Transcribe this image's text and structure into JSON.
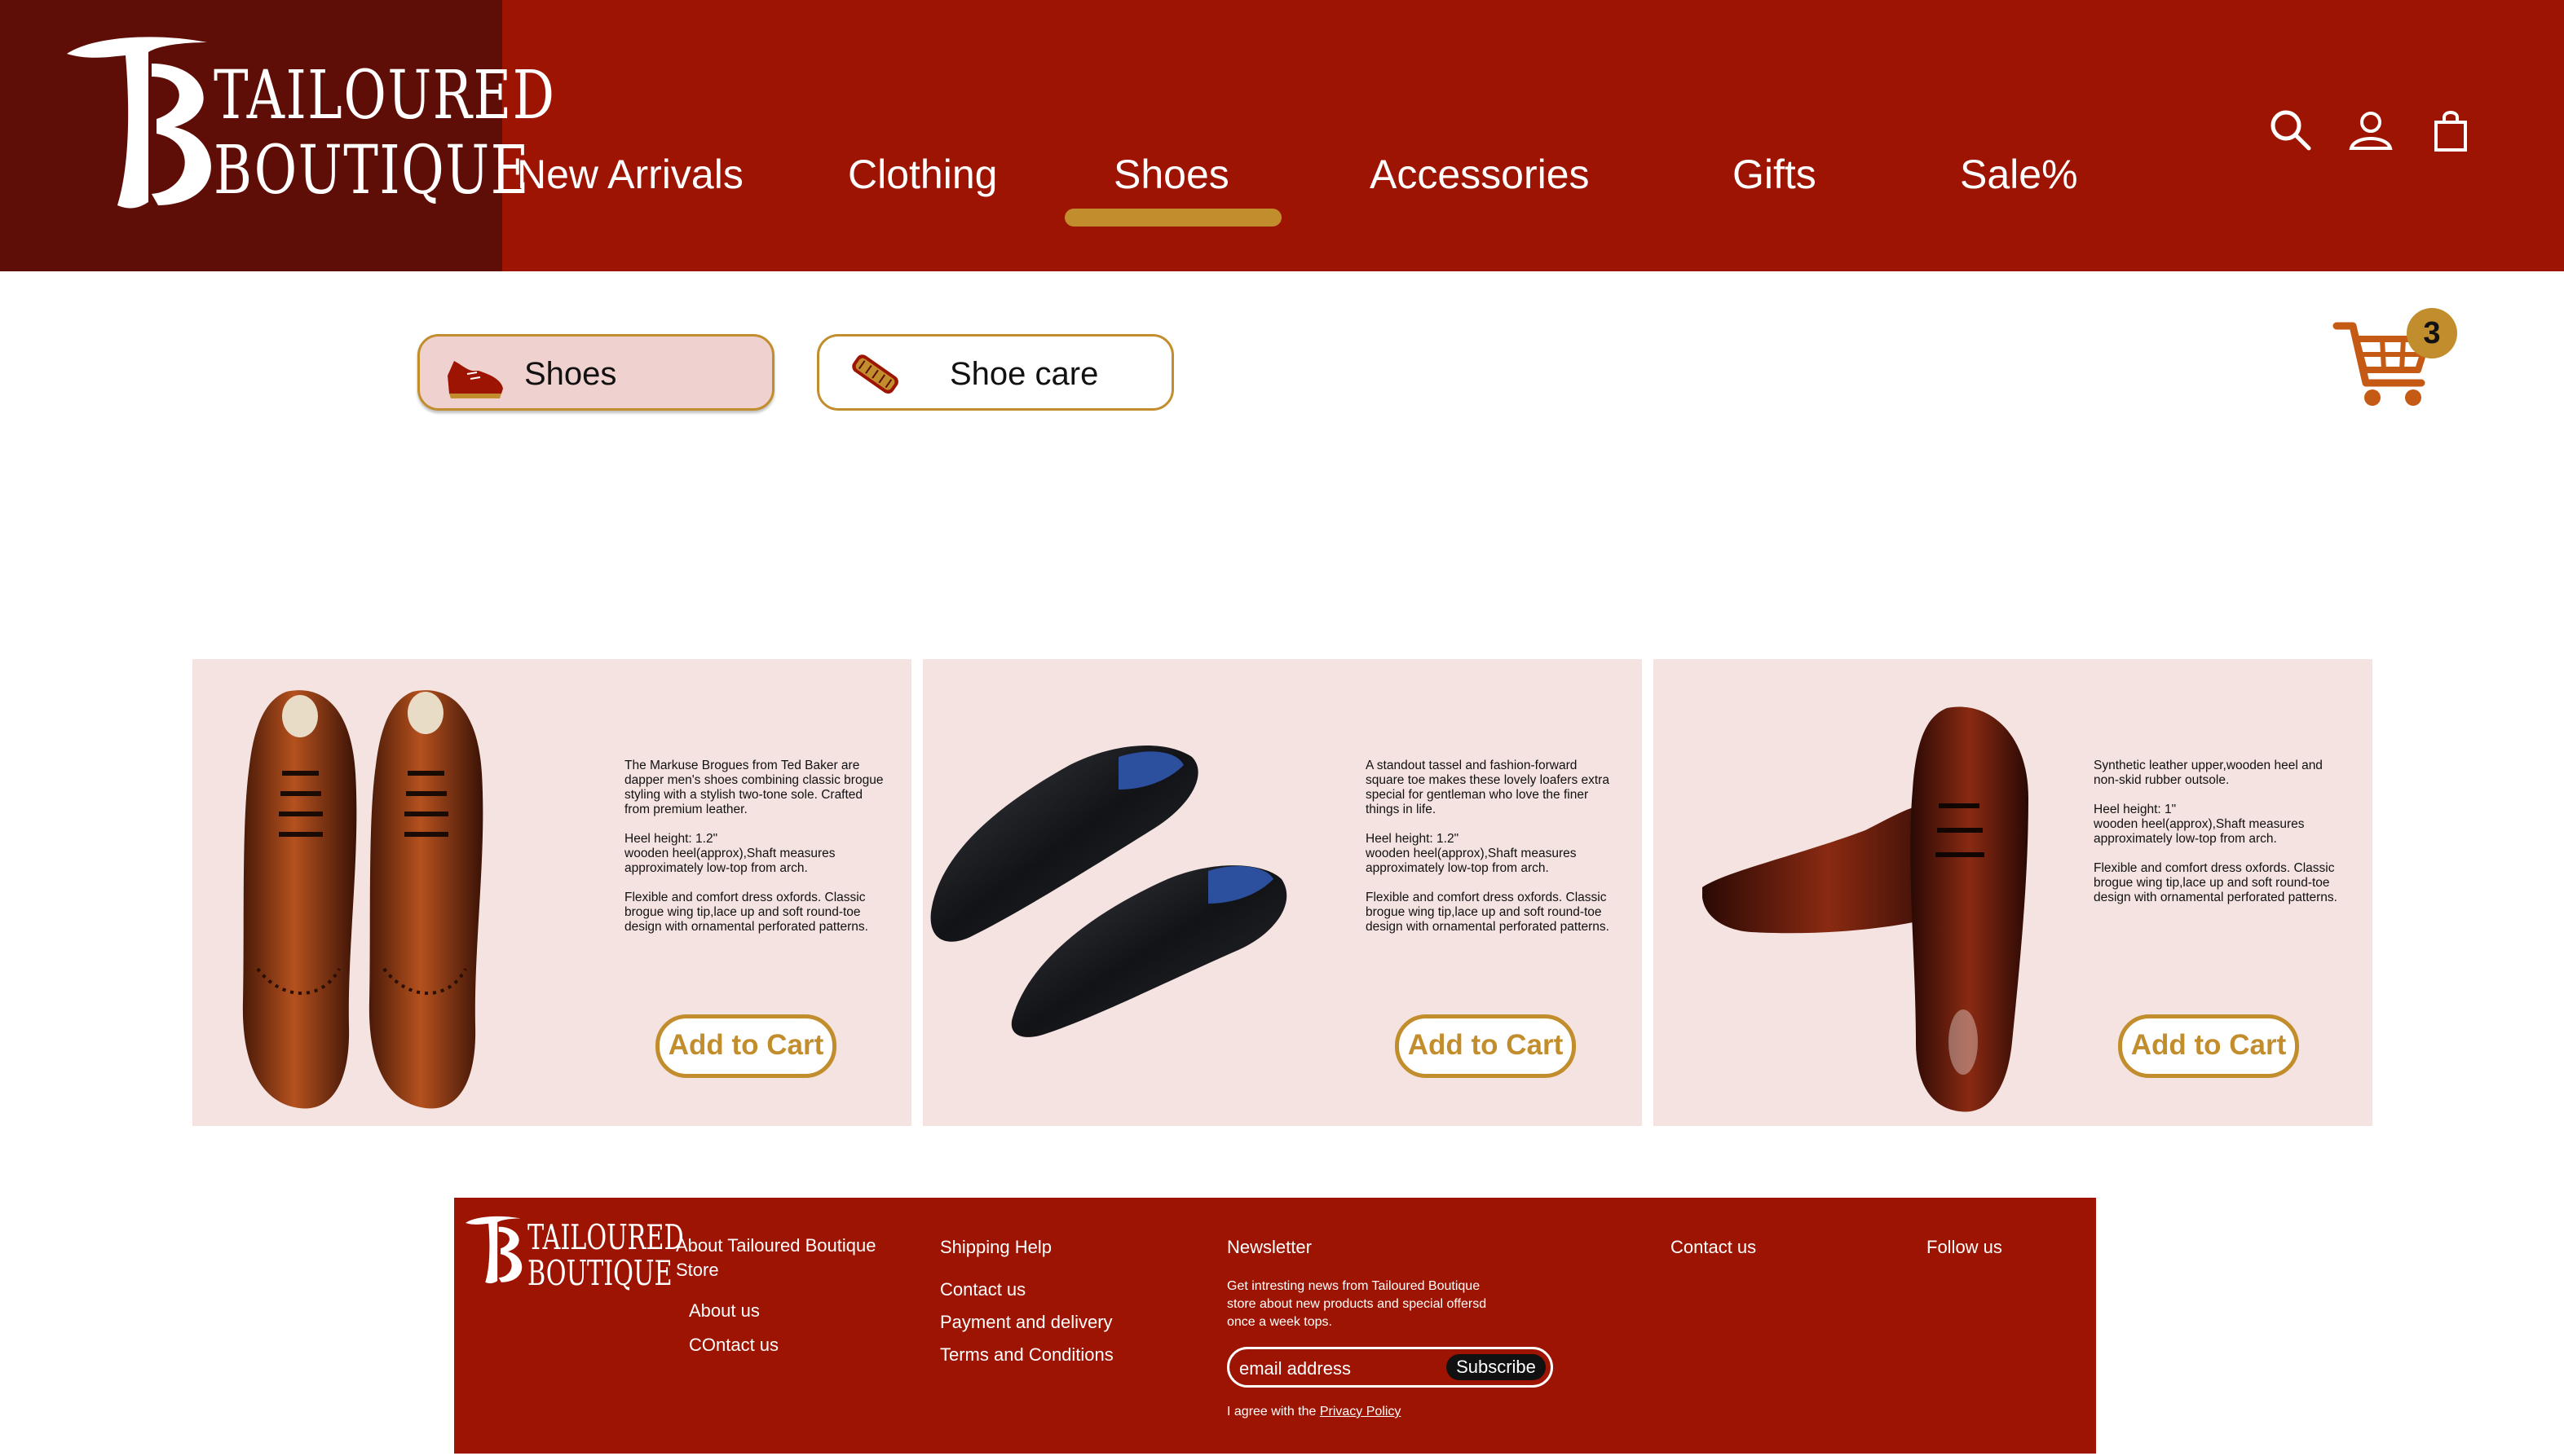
{
  "brand": {
    "line1": "TAILOURED",
    "line2": "BOUTIQUE"
  },
  "nav": {
    "items": [
      {
        "label": "New Arrivals"
      },
      {
        "label": "Clothing"
      },
      {
        "label": "Shoes"
      },
      {
        "label": "Accessories"
      },
      {
        "label": "Gifts"
      },
      {
        "label": "Sale%"
      }
    ],
    "active": "Shoes"
  },
  "header_icons": [
    "search-icon",
    "user-icon",
    "shopping-bag-icon"
  ],
  "categories": [
    {
      "label": "Shoes",
      "icon": "shoe-icon",
      "selected": true
    },
    {
      "label": "Shoe care",
      "icon": "shoe-brush-icon",
      "selected": false
    }
  ],
  "cart": {
    "count": "3",
    "icon": "cart-icon"
  },
  "products": [
    {
      "image": "brown-brogue-shoes-top-view",
      "description": "The Markuse Brogues from Ted Baker are dapper men's shoes combining classic brogue styling with a stylish two-tone sole. Crafted from premium leather.\n\nHeel height: 1.2\"\nwooden heel(approx),Shaft measures approximately low-top from arch.\n\nFlexible and comfort dress oxfords. Classic brogue wing tip,lace up and soft round-toe design with ornamental perforated patterns.",
      "cta": "Add to Cart"
    },
    {
      "image": "black-wingtip-shoes",
      "description": "A standout tassel and fashion-forward square toe makes these lovely loafers extra special for gentleman who love the finer things in life.\n\nHeel height: 1.2\"\nwooden heel(approx),Shaft measures approximately low-top from arch.\n\nFlexible and comfort dress oxfords. Classic brogue wing tip,lace up and soft round-toe design with ornamental perforated patterns.",
      "cta": "Add to Cart"
    },
    {
      "image": "burgundy-oxford-shoes",
      "description": "Synthetic leather upper,wooden heel and non-skid rubber outsole.\n\nHeel height: 1\"\nwooden heel(approx),Shaft measures approximately low-top from arch.\n\nFlexible and comfort dress oxfords. Classic brogue wing tip,lace up and soft round-toe design with ornamental perforated patterns.",
      "cta": "Add to Cart"
    }
  ],
  "footer": {
    "brand": {
      "line1": "TAILOURED",
      "line2": "BOUTIQUE"
    },
    "about_title": "About Tailoured Boutique Store",
    "about_links": [
      "About us",
      "COntact us"
    ],
    "shipping_title": "Shipping Help",
    "shipping_links": [
      "Contact us",
      "Payment and delivery",
      "Terms and Conditions"
    ],
    "newsletter_title": "Newsletter",
    "newsletter_text": "Get intresting news  from Tailoured Boutique store about new products and special offersd once a week tops.",
    "email_placeholder": "email address",
    "subscribe_label": "Subscribe",
    "agree_text": "I agree with the ",
    "privacy_link": "Privacy Policy",
    "contact_title": "Contact us",
    "follow_title": "Follow us"
  },
  "colors": {
    "header_red": "#9e1402",
    "logo_maroon": "#5e0e07",
    "gold": "#c28d2c",
    "card_bg": "#f4e3e0",
    "pill_selected": "#efd2cf"
  }
}
